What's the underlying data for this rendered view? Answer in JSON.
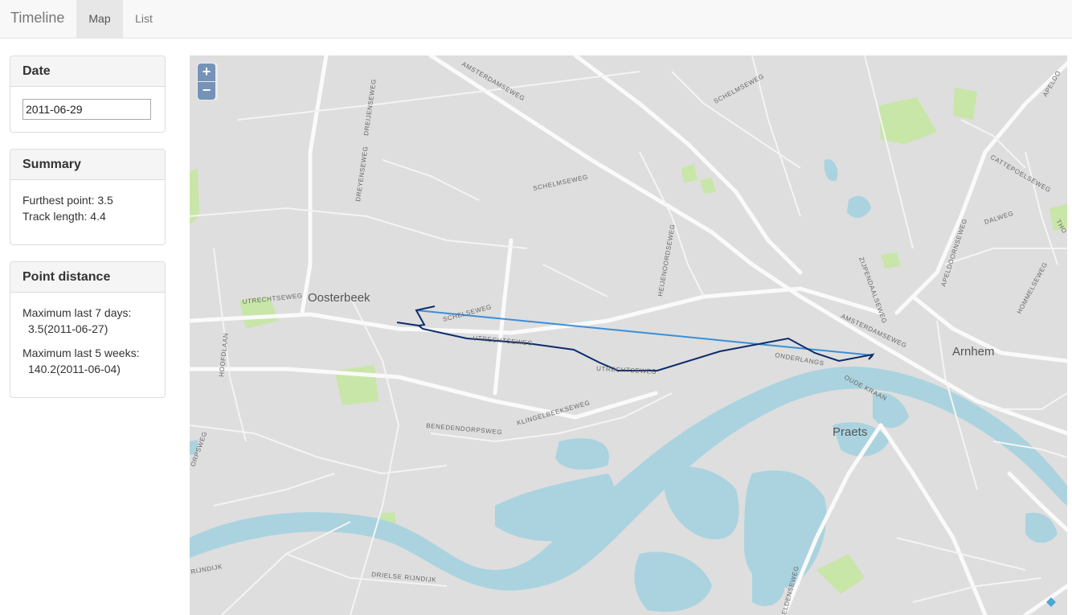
{
  "navbar": {
    "brand": "Timeline",
    "tabs": [
      {
        "label": "Map",
        "active": true
      },
      {
        "label": "List",
        "active": false
      }
    ]
  },
  "panels": {
    "date": {
      "title": "Date",
      "value": "2011-06-29"
    },
    "summary": {
      "title": "Summary",
      "furthest_point": "Furthest point: 3.5",
      "track_length": "Track length: 4.4"
    },
    "point_distance": {
      "title": "Point distance",
      "last7_label": "Maximum last 7 days:",
      "last7_value": "3.5(2011-06-27)",
      "last5w_label": "Maximum last 5 weeks:",
      "last5w_value": "140.2(2011-06-04)"
    }
  },
  "map": {
    "zoom_in": "+",
    "zoom_out": "−",
    "places": {
      "oosterbeek": "Oosterbeek",
      "arnhem": "Arnhem",
      "praets": "Praets"
    },
    "streets": {
      "amsterdamseweg_n": "AMSTERDAMSEWEG",
      "schelmseweg_ne": "SCHELMSEWEG",
      "schelmseweg": "SCHELMSEWEG",
      "dreyenseweg": "DREYENSEWEG",
      "dreijenseweg": "DREIJENSEWEG",
      "utrechtseweg_w": "UTRECHTSEWEG",
      "scheelsweg": "SCHELSEWEG",
      "utrechtseweg_c": "UTRECHTSEWEG",
      "utrechtseweg_s": "UTRECHTSEWEG",
      "heijenoordseweg": "HEIJENOORDSEWEG",
      "zijpendaalseweg": "ZIJPENDAALSEWEG",
      "amsterdamseweg_e": "AMSTERDAMSEWEG",
      "onderlangs": "ONDERLANGS",
      "oude_kraan": "OUDE KRAAN",
      "apeldoornseweg": "APELDOORNSEWEG",
      "cattepoelseweg": "CATTEPOELSEWEG",
      "dalweg": "DALWEG",
      "hommelseweg": "HOMMELSEWEG",
      "hoofdlaan": "HOOFDLAAN",
      "benedendorpsweg": "BENEDENDORPSWEG",
      "klingelbeekseweg": "KLINGELBEEKSEWEG",
      "dorpsweg": "ORPSWEG",
      "rijndijk": "RIJNDIJK",
      "drielse_rijndijk": "DRIELSE RIJNDIJK",
      "eldenseweg": "ELDENSEWEG",
      "apeldo": "APELDO",
      "tho": "THO"
    }
  },
  "colors": {
    "track_dark": "#0d2c6b",
    "track_light": "#3a8fd8",
    "water": "#aad3df",
    "park": "#c8e6a8"
  }
}
